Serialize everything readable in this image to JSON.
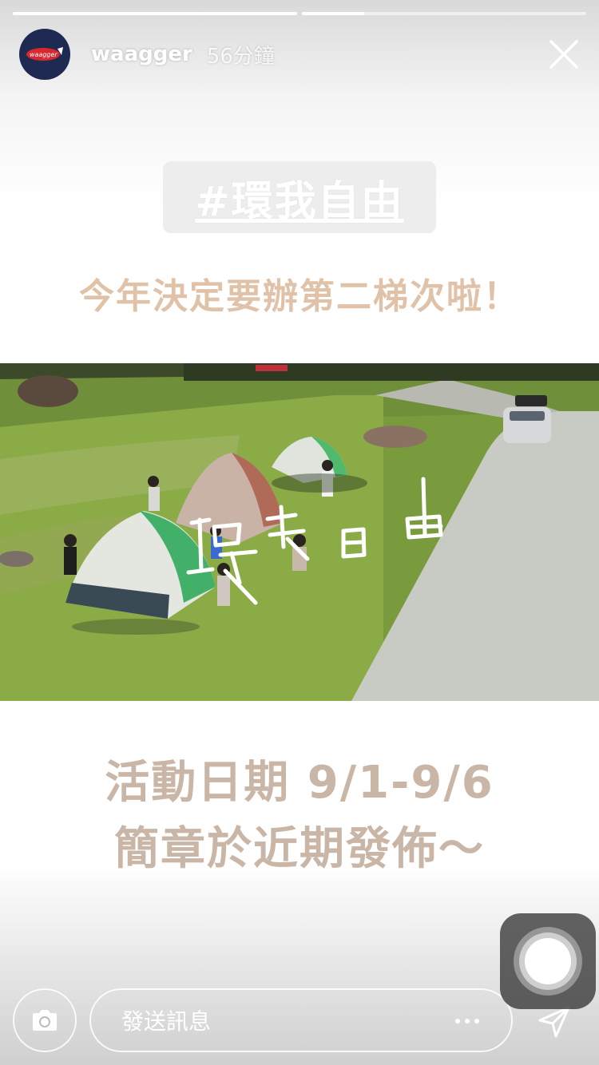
{
  "story": {
    "progress": [
      1.0,
      0.22,
      0.0
    ],
    "username": "waagger",
    "time_ago": "56分鐘",
    "avatar_logo_text": "waagger"
  },
  "content": {
    "hashtag": "#環我自由",
    "headline": "今年決定要辦第二梯次啦！",
    "photo_handwriting": "環我自由",
    "event_date": "活動日期 9/1-9/6",
    "event_note": "簡章於近期發佈～"
  },
  "footer": {
    "message_placeholder": "發送訊息",
    "icons": {
      "camera": "camera-icon",
      "more": "more-icon",
      "send": "send-icon",
      "close": "close-icon",
      "assistive": "assistive-touch-icon"
    }
  },
  "colors": {
    "headline": "#e0c2a8",
    "event_text": "#c9b6a6",
    "avatar_bg": "#1f2a52"
  }
}
